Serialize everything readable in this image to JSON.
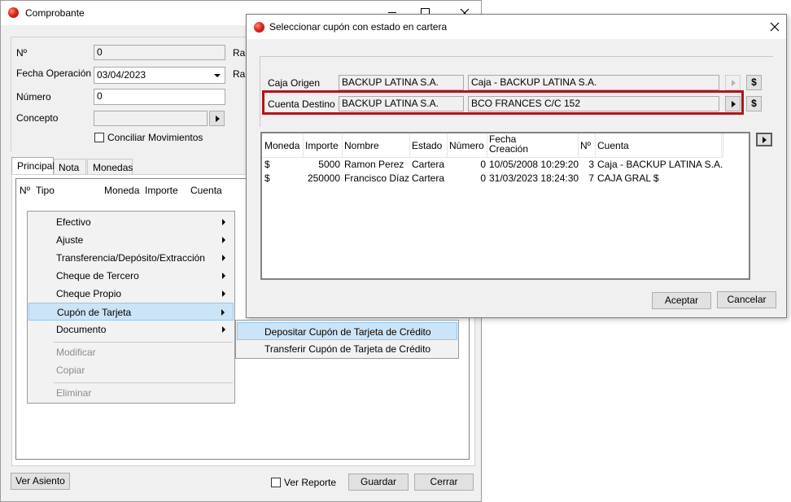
{
  "comprobante": {
    "title": "Comprobante",
    "labels": {
      "numero_corto": "Nº",
      "fecha": "Fecha Operación",
      "numero": "Número",
      "concepto": "Concepto",
      "raz1": "Ra",
      "raz2": "Ra"
    },
    "values": {
      "numero_corto": "0",
      "fecha": "03/04/2023",
      "numero": "0",
      "concepto": ""
    },
    "conciliar_label": "Conciliar Movimientos",
    "tabs": [
      "Principal",
      "Nota",
      "Monedas"
    ],
    "grid_headers": [
      "Nº",
      "Tipo",
      "Moneda",
      "Importe",
      "Cuenta"
    ],
    "buttons": {
      "ver_asiento": "Ver Asiento",
      "ver_reporte": "Ver Reporte",
      "guardar": "Guardar",
      "cerrar": "Cerrar"
    }
  },
  "context_menu": {
    "items": [
      {
        "label": "Efectivo",
        "submenu": true
      },
      {
        "label": "Ajuste",
        "submenu": true
      },
      {
        "label": "Transferencia/Depósito/Extracción",
        "submenu": true
      },
      {
        "label": "Cheque de Tercero",
        "submenu": true
      },
      {
        "label": "Cheque Propio",
        "submenu": true
      },
      {
        "label": "Cupón de Tarjeta",
        "submenu": true,
        "highlighted": true
      },
      {
        "label": "Documento",
        "submenu": true
      },
      {
        "label": "Modificar",
        "disabled": true
      },
      {
        "label": "Copiar",
        "disabled": true
      },
      {
        "label": "Eliminar",
        "disabled": true
      }
    ],
    "submenu": [
      {
        "label": "Depositar Cupón de Tarjeta de Crédito",
        "highlighted": true
      },
      {
        "label": "Transferir Cupón de Tarjeta de Crédito"
      }
    ]
  },
  "dialog": {
    "title": "Seleccionar cupón con estado en cartera",
    "caja_origen": {
      "label": "Caja Origen",
      "empresa": "BACKUP LATINA S.A.",
      "cuenta": "Caja - BACKUP LATINA S.A."
    },
    "cuenta_destino": {
      "label": "Cuenta Destino",
      "empresa": "BACKUP LATINA S.A.",
      "cuenta": "BCO FRANCES C/C 152"
    },
    "dollar": "$",
    "highlight_color": "#b0141c",
    "table": {
      "headers": [
        "Moneda",
        "Importe",
        "Nombre",
        "Estado",
        "Número",
        "Fecha Creación",
        "Nº",
        "Cuenta"
      ],
      "rows": [
        [
          "$",
          "5000",
          "Ramon Perez",
          "Cartera",
          "0",
          "10/05/2008 10:29:20",
          "3",
          "Caja - BACKUP LATINA S.A."
        ],
        [
          "$",
          "250000",
          "Francisco Díaz",
          "Cartera",
          "0",
          "31/03/2023 18:24:30",
          "7",
          "CAJA GRAL $"
        ]
      ]
    },
    "buttons": {
      "aceptar": "Aceptar",
      "cancelar": "Cancelar"
    }
  }
}
